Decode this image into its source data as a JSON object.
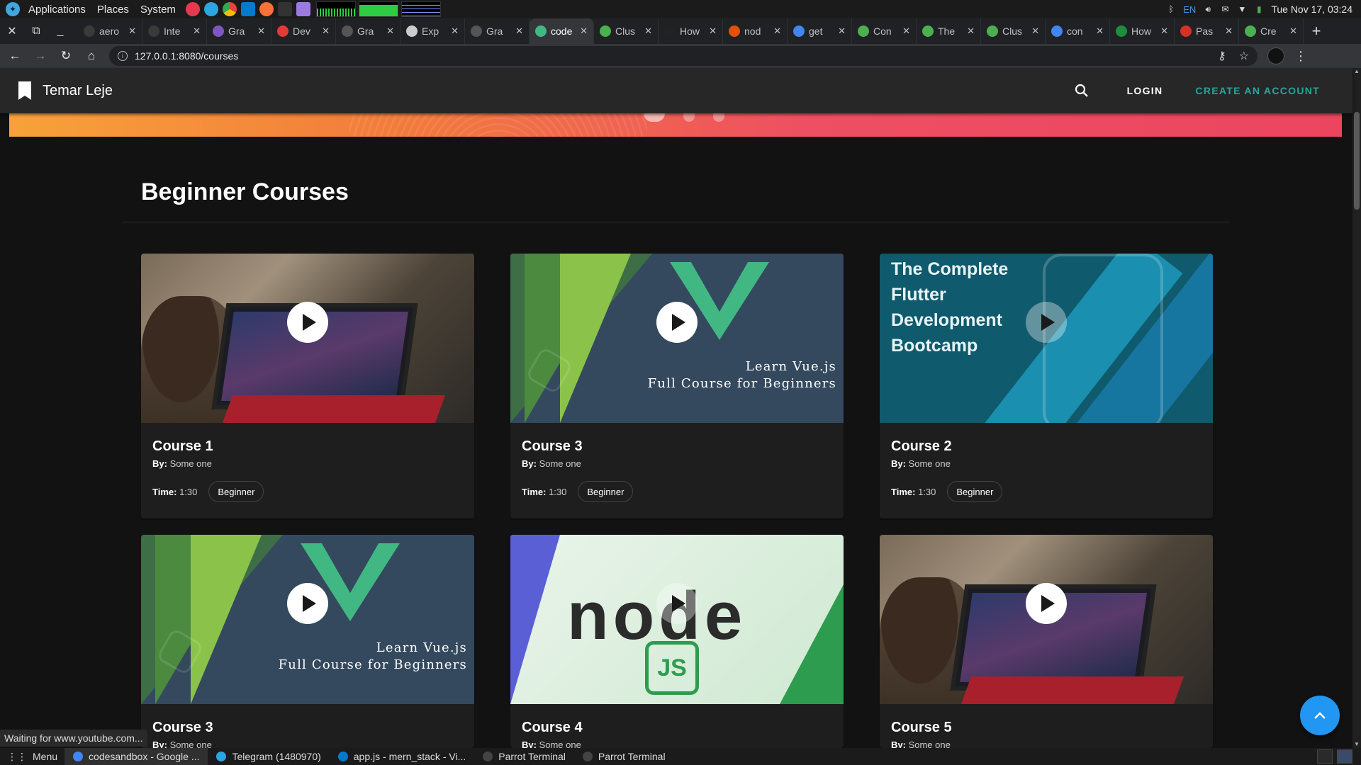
{
  "os": {
    "applications": "Applications",
    "places": "Places",
    "system": "System",
    "lang": "EN",
    "clock": "Tue Nov 17, 03:24"
  },
  "tabs": [
    {
      "label": "aero",
      "color": "#3a3a3a"
    },
    {
      "label": "Inte",
      "color": "#3a3a3a"
    },
    {
      "label": "Gra",
      "color": "#7e57c2"
    },
    {
      "label": "Dev",
      "color": "#e53935"
    },
    {
      "label": "Gra",
      "color": "#555555"
    },
    {
      "label": "Exp",
      "color": "#cccccc"
    },
    {
      "label": "Gra",
      "color": "#555555"
    },
    {
      "label": "code",
      "color": "#41b883",
      "active": true
    },
    {
      "label": "Clus",
      "color": "#4caf50"
    },
    {
      "label": "How",
      "color": "#222222"
    },
    {
      "label": "nod",
      "color": "#e65100"
    },
    {
      "label": "get",
      "color": "#4285f4"
    },
    {
      "label": "Con",
      "color": "#4caf50"
    },
    {
      "label": "The",
      "color": "#4caf50"
    },
    {
      "label": "Clus",
      "color": "#4caf50"
    },
    {
      "label": "con",
      "color": "#4285f4"
    },
    {
      "label": "How",
      "color": "#1e8e3e"
    },
    {
      "label": "Pas",
      "color": "#d93025"
    },
    {
      "label": "Cre",
      "color": "#4caf50"
    }
  ],
  "address": {
    "url": "127.0.0.1:8080/courses"
  },
  "app": {
    "brand": "Temar Leje",
    "login": "LOGIN",
    "create_account": "CREATE AN ACCOUNT"
  },
  "section": {
    "title": "Beginner Courses"
  },
  "course_labels": {
    "by": "By:",
    "time": "Time:"
  },
  "courses": [
    {
      "title": "Course 1",
      "author": "Some one",
      "time": "1:30",
      "level": "Beginner",
      "art": "classroom"
    },
    {
      "title": "Course 3",
      "author": "Some one",
      "time": "1:30",
      "level": "Beginner",
      "art": "vue",
      "art_text": [
        "Learn Vue.js",
        "Full Course for Beginners"
      ]
    },
    {
      "title": "Course 2",
      "author": "Some one",
      "time": "1:30",
      "level": "Beginner",
      "art": "flutter",
      "art_text": [
        "The Complete",
        "Flutter",
        "Development",
        "Bootcamp"
      ]
    },
    {
      "title": "Course 3",
      "author": "Some one",
      "art": "vue",
      "art_text": [
        "Learn Vue.js",
        "Full Course for Beginners"
      ]
    },
    {
      "title": "Course 4",
      "author": "Some one",
      "art": "node",
      "art_text": [
        "node",
        "JS"
      ]
    },
    {
      "title": "Course 5",
      "author": "Some one",
      "art": "classroom"
    }
  ],
  "status_bar": "Waiting for www.youtube.com...",
  "taskbar": {
    "menu": "Menu",
    "items": [
      {
        "label": "codesandbox - Google ...",
        "active": true,
        "color": "#4285f4"
      },
      {
        "label": "Telegram (1480970)",
        "color": "#2ca5e0"
      },
      {
        "label": "app.js - mern_stack - Vi...",
        "color": "#007acc"
      },
      {
        "label": "Parrot Terminal",
        "color": "#444444"
      },
      {
        "label": "Parrot Terminal",
        "color": "#444444"
      }
    ]
  },
  "colors": {
    "accent_teal": "#26a69a",
    "fab_blue": "#2196f3",
    "appbar": "#272727",
    "background": "#121212"
  }
}
